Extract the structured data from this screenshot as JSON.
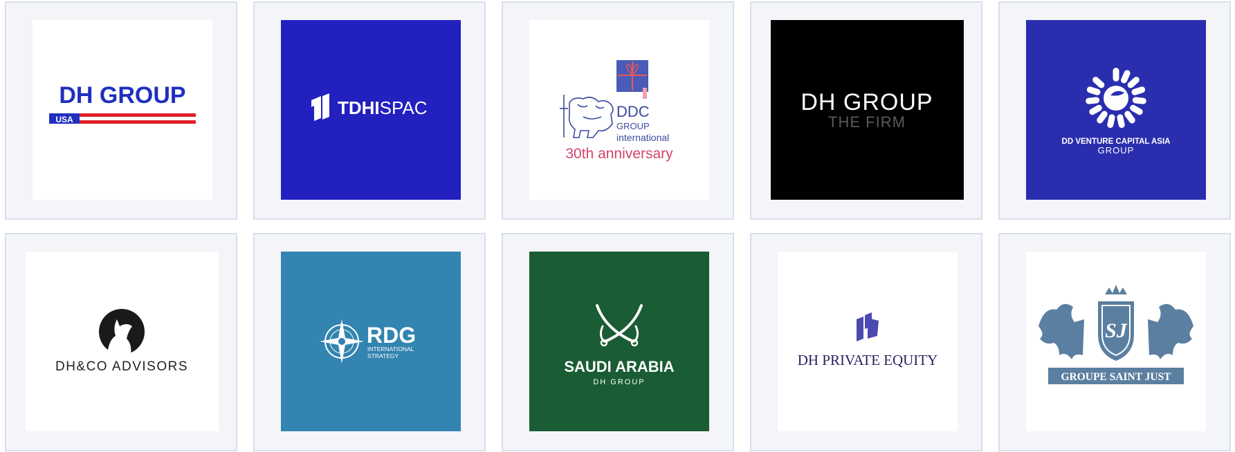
{
  "logos": [
    {
      "name": "DH Group USA",
      "line1": "DH GROUP",
      "line2": "USA",
      "bg": "#ffffff",
      "accent": "#1f2fbf",
      "accent2": "#e0202a"
    },
    {
      "name": "TDHI SPAC",
      "line1": "TDHI",
      "line2": "SPAC",
      "bg": "#2220bf",
      "accent": "#ffffff"
    },
    {
      "name": "DDC Group International 30th anniversary",
      "line1": "DDC",
      "line2": "GROUP",
      "line3": "international",
      "line4": "30th anniversary",
      "bg": "#ffffff",
      "accent": "#3b4a9e",
      "accent2": "#d2436a"
    },
    {
      "name": "DH Group The Firm",
      "line1": "DH GROUP",
      "line2": "THE FIRM",
      "bg": "#000000",
      "accent": "#ffffff"
    },
    {
      "name": "DD Venture Capital Asia Group",
      "line1": "DD VENTURE CAPITAL ASIA",
      "line2": "GROUP",
      "bg": "#2a2eae",
      "accent": "#ffffff"
    },
    {
      "name": "DH&CO Advisors",
      "line1": "DH&CO ADVISORS",
      "bg": "#ffffff",
      "accent": "#222222"
    },
    {
      "name": "RDG International Strategy",
      "line1": "RDG",
      "line2": "INTERNATIONAL",
      "line3": "STRATEGY",
      "bg": "#3384b0",
      "accent": "#ffffff"
    },
    {
      "name": "Saudi Arabia DH Group",
      "line1": "SAUDI ARABIA",
      "line2": "DH GROUP",
      "bg": "#1a5c33",
      "accent": "#ffffff"
    },
    {
      "name": "DH Private Equity",
      "line1": "DH PRIVATE EQUITY",
      "bg": "#ffffff",
      "accent": "#2a1f5e",
      "accent2": "#4a4ab0"
    },
    {
      "name": "Groupe Saint Just",
      "line1": "GROUPE SAINT JUST",
      "monogram": "SJ",
      "bg": "#ffffff",
      "accent": "#5b7fa0"
    }
  ]
}
